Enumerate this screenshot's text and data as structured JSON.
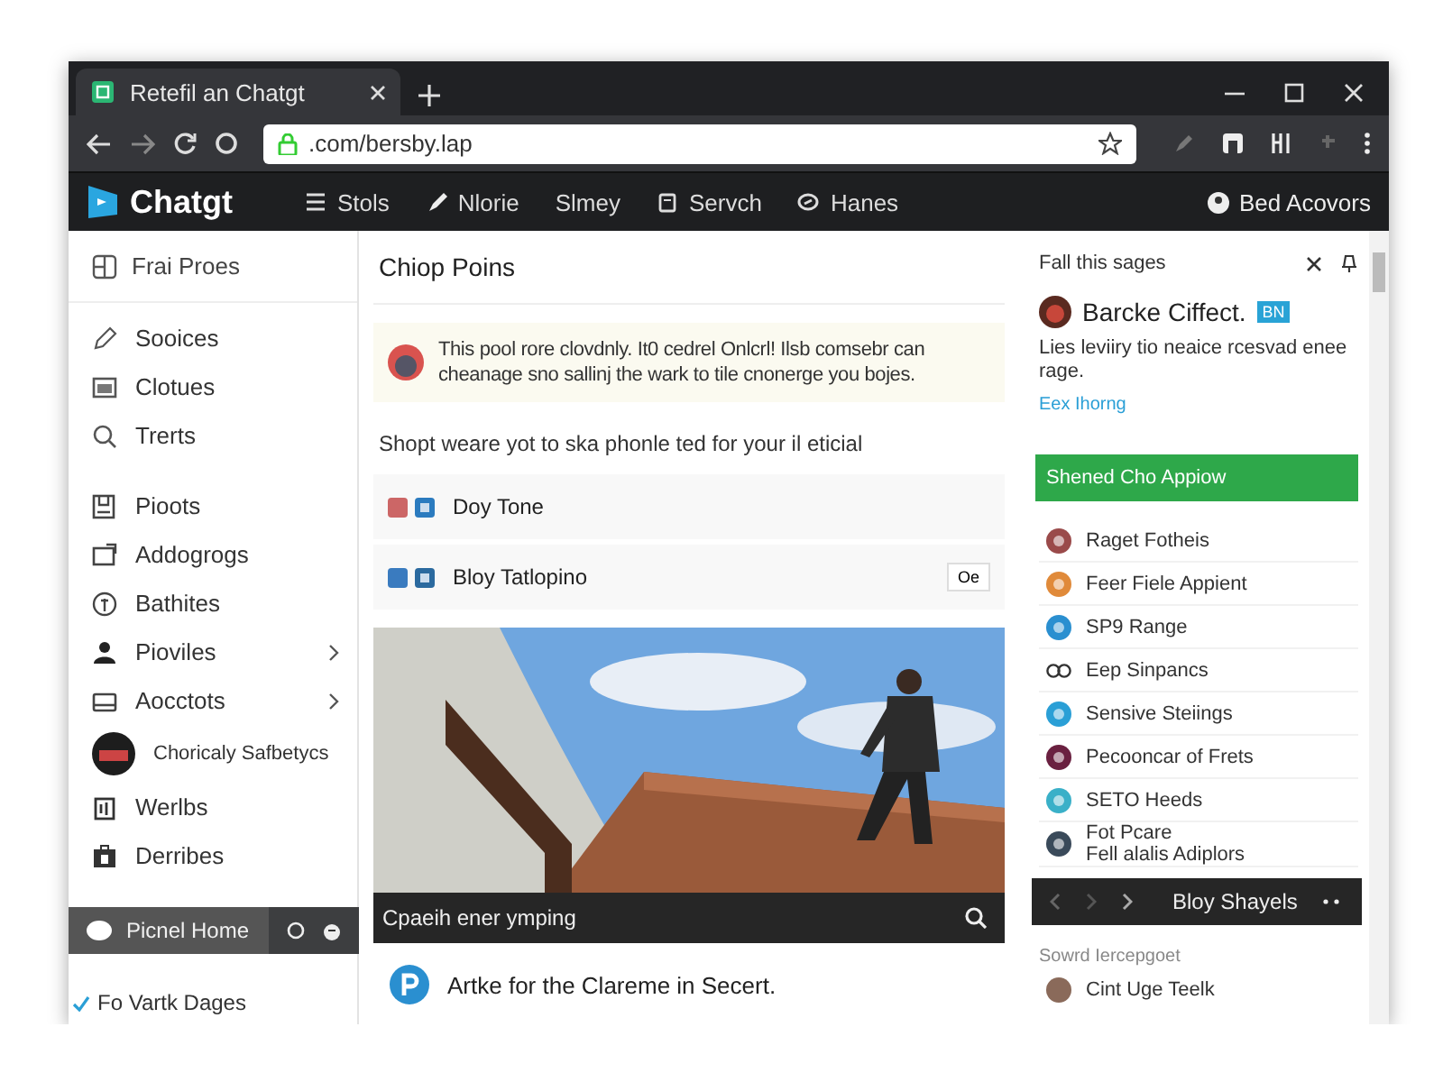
{
  "window": {
    "tab_title": "Retefil an Chatgt",
    "url": ".com/bersby.lap"
  },
  "nav": {
    "brand": "Chatgt",
    "items": [
      "Stols",
      "Nlorie",
      "Slmey",
      "Servch",
      "Hanes"
    ],
    "account": "Bed Acovors"
  },
  "sidebar": {
    "header": "Frai Proes",
    "groups": [
      {
        "items": [
          {
            "label": "Sooices",
            "submenu": false
          },
          {
            "label": "Clotues",
            "submenu": false
          },
          {
            "label": "Trerts",
            "submenu": false
          }
        ]
      },
      {
        "items": [
          {
            "label": "Pioots",
            "submenu": false
          },
          {
            "label": "Addogrogs",
            "submenu": false
          },
          {
            "label": "Bathites",
            "submenu": false
          },
          {
            "label": "Pioviles",
            "submenu": true
          },
          {
            "label": "Aocctots",
            "submenu": true
          },
          {
            "label": "Choricaly Safbetycs",
            "submenu": false
          },
          {
            "label": "Werlbs",
            "submenu": false
          },
          {
            "label": "Derribes",
            "submenu": false
          }
        ]
      }
    ],
    "active_item": {
      "label": "Picnel Home",
      "selected": true
    },
    "footer_item": {
      "label": "Fo Vartk Dages",
      "checked": true
    }
  },
  "main": {
    "title": "Chiop Poins",
    "notice": "This pool rore clovdnly. It0 cedrel Onlcrl! Ilsb comsebr can cheanage sno sallinj the wark to tile cnonerge you bojes.",
    "prompt": "Shopt weare yot to ska phonle ted for your il eticial",
    "rows": [
      {
        "name": "Doy Tone"
      },
      {
        "name": "Bloy Tatlopino",
        "action": "Oe"
      }
    ],
    "media": {
      "kind": "picture",
      "caption": "Cpaeih ener ymping"
    },
    "article": "Artke for the Clareme in Secert."
  },
  "panel": {
    "title": "Fall this sages",
    "profile": {
      "name": "Barcke Ciffect.",
      "badge": "BN",
      "description": "Lies leviiry tio neaice rcesvad enee rage.",
      "link": "Eex Ihorng"
    },
    "action": "Shened Cho Appiow",
    "items": [
      {
        "label": "Raget Fotheis"
      },
      {
        "label": "Feer Fiele Appient"
      },
      {
        "label": "SP9 Range"
      },
      {
        "label": "Eep Sinpancs"
      },
      {
        "label": "Sensive Steiings"
      },
      {
        "label": "Pecooncar of Frets"
      },
      {
        "label": "SETO Heeds"
      },
      {
        "label": "Fot Pcare",
        "sublabel": "Fell alalis Adiplors"
      }
    ],
    "player": {
      "title": "Bloy Shayels"
    },
    "section": "Sowrd Iercepgoet",
    "last_item": "Cint Uge Teelk"
  }
}
